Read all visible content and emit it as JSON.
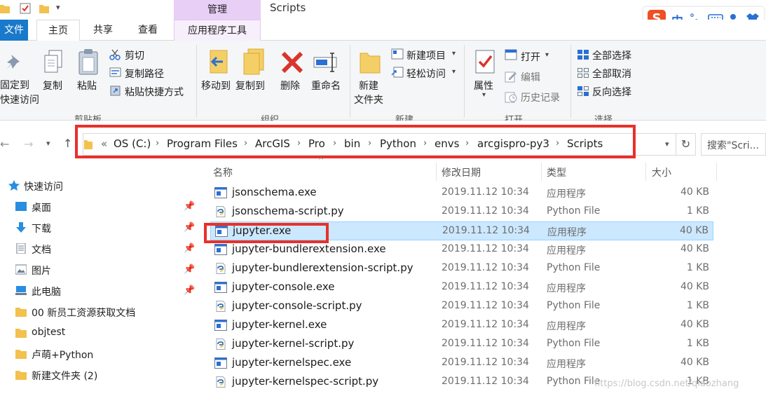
{
  "window": {
    "title": "Scripts",
    "context_tab": "管理",
    "quick_access_dropdown": "▾"
  },
  "tabs": {
    "file": "文件",
    "home": "主页",
    "share": "共享",
    "view": "查看",
    "app_tools": "应用程序工具"
  },
  "ribbon": {
    "pin_line1": "固定到",
    "pin_line2": "快速访问",
    "copy": "复制",
    "paste": "粘贴",
    "cut": "剪切",
    "copy_path": "复制路径",
    "paste_shortcut": "粘贴快捷方式",
    "group_clipboard": "剪贴板",
    "move_to": "移动到",
    "copy_to": "复制到",
    "delete": "删除",
    "rename": "重命名",
    "group_organize": "组织",
    "new_folder_line1": "新建",
    "new_folder_line2": "文件夹",
    "new_item": "新建项目",
    "easy_access": "轻松访问",
    "group_new": "新建",
    "properties": "属性",
    "open": "打开",
    "edit": "编辑",
    "history": "历史记录",
    "group_open": "打开",
    "select_all": "全部选择",
    "select_none": "全部取消",
    "invert_selection": "反向选择",
    "group_select": "选择"
  },
  "address": {
    "overflow": "«",
    "crumbs": [
      "OS (C:)",
      "Program Files",
      "ArcGIS",
      "Pro",
      "bin",
      "Python",
      "envs",
      "arcgispro-py3",
      "Scripts"
    ],
    "search_placeholder": "搜索\"Scri..."
  },
  "sidebar": {
    "items": [
      {
        "label": "快速访问",
        "icon": "star-icon",
        "pinned": false
      },
      {
        "label": "桌面",
        "icon": "desktop-icon",
        "pinned": true
      },
      {
        "label": "下载",
        "icon": "download-icon",
        "pinned": true
      },
      {
        "label": "文档",
        "icon": "document-icon",
        "pinned": true
      },
      {
        "label": "图片",
        "icon": "picture-icon",
        "pinned": true
      },
      {
        "label": "此电脑",
        "icon": "computer-icon",
        "pinned": true
      },
      {
        "label": "00 新员工资源获取文档",
        "icon": "folder-icon",
        "pinned": false
      },
      {
        "label": "objtest",
        "icon": "folder-icon",
        "pinned": false
      },
      {
        "label": "卢萌+Python",
        "icon": "folder-icon",
        "pinned": false
      },
      {
        "label": "新建文件夹 (2)",
        "icon": "folder-icon",
        "pinned": false
      }
    ]
  },
  "columns": {
    "name": "名称",
    "date": "修改日期",
    "type": "类型",
    "size": "大小"
  },
  "files": [
    {
      "name": "jsonschema.exe",
      "date": "2019.11.12 10:34",
      "type": "应用程序",
      "size": "40 KB",
      "kind": "exe"
    },
    {
      "name": "jsonschema-script.py",
      "date": "2019.11.12 10:34",
      "type": "Python File",
      "size": "1 KB",
      "kind": "py"
    },
    {
      "name": "jupyter.exe",
      "date": "2019.11.12 10:34",
      "type": "应用程序",
      "size": "40 KB",
      "kind": "exe",
      "selected": true
    },
    {
      "name": "jupyter-bundlerextension.exe",
      "date": "2019.11.12 10:34",
      "type": "应用程序",
      "size": "40 KB",
      "kind": "exe"
    },
    {
      "name": "jupyter-bundlerextension-script.py",
      "date": "2019.11.12 10:34",
      "type": "Python File",
      "size": "1 KB",
      "kind": "py"
    },
    {
      "name": "jupyter-console.exe",
      "date": "2019.11.12 10:34",
      "type": "应用程序",
      "size": "40 KB",
      "kind": "exe"
    },
    {
      "name": "jupyter-console-script.py",
      "date": "2019.11.12 10:34",
      "type": "Python File",
      "size": "1 KB",
      "kind": "py"
    },
    {
      "name": "jupyter-kernel.exe",
      "date": "2019.11.12 10:34",
      "type": "应用程序",
      "size": "40 KB",
      "kind": "exe"
    },
    {
      "name": "jupyter-kernel-script.py",
      "date": "2019.11.12 10:34",
      "type": "Python File",
      "size": "1 KB",
      "kind": "py"
    },
    {
      "name": "jupyter-kernelspec.exe",
      "date": "2019.11.12 10:34",
      "type": "应用程序",
      "size": "40 KB",
      "kind": "exe"
    },
    {
      "name": "jupyter-kernelspec-script.py",
      "date": "2019.11.12 10:34",
      "type": "Python File",
      "size": "1 KB",
      "kind": "py"
    }
  ],
  "ime": {
    "logo": "S",
    "mode": "中",
    "punct": "°,"
  },
  "watermark": "https://blog.csdn.net/qiaozhang",
  "colors": {
    "accent": "#1979ca",
    "selection": "#cce8ff",
    "highlight": "#e8302b",
    "manage_tab": "#e8cff5"
  }
}
